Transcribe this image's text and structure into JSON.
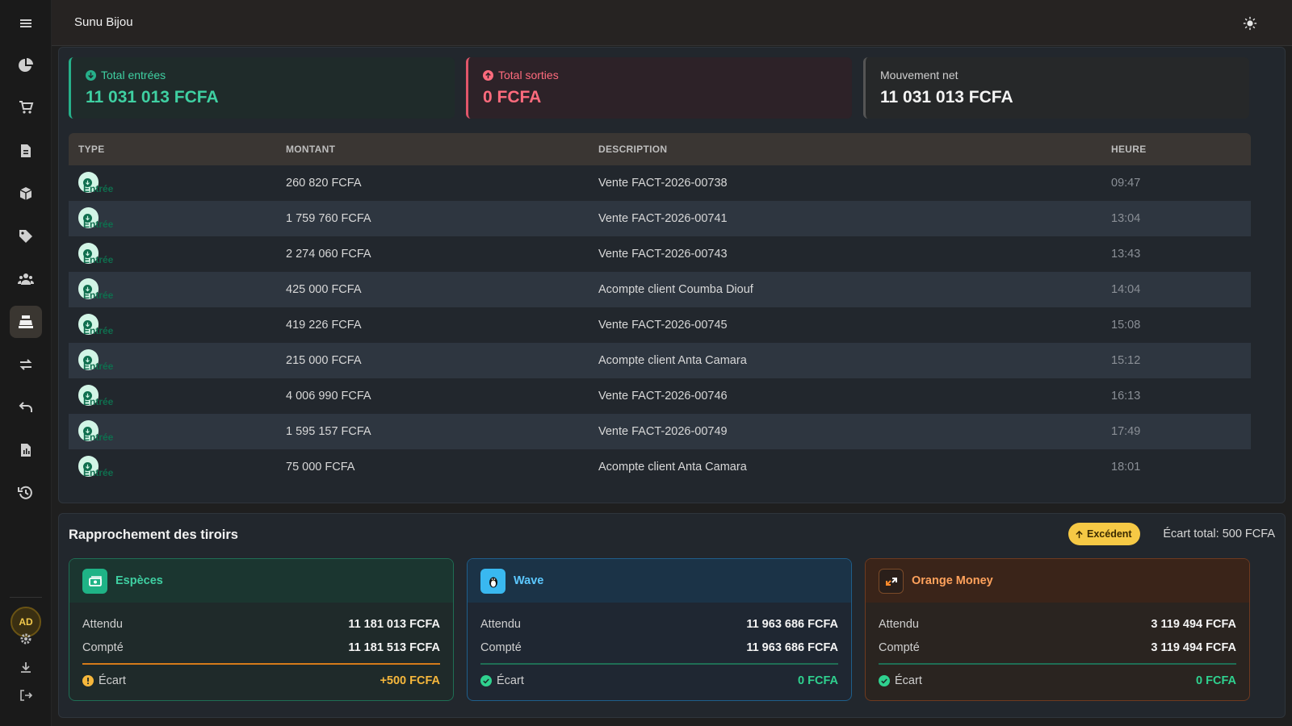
{
  "app": {
    "title": "Sunu Bijou"
  },
  "sidebar": {
    "icons": [
      "menu-icon",
      "dashboard-pie-icon",
      "cart-icon",
      "invoice-icon",
      "box-icon",
      "tag-icon",
      "customers-icon",
      "cash-register-icon",
      "transfer-icon",
      "return-icon",
      "report-icon",
      "history-icon"
    ],
    "active": "cash-register-icon",
    "avatar_initials": "AD"
  },
  "stats": {
    "in_label": "Total entrées",
    "in_value": "11 031 013 FCFA",
    "out_label": "Total sorties",
    "out_value": "0 FCFA",
    "net_label": "Mouvement net",
    "net_value": "11 031 013 FCFA"
  },
  "table": {
    "headers": {
      "type": "TYPE",
      "amount": "MONTANT",
      "description": "DESCRIPTION",
      "time": "HEURE"
    },
    "rows": [
      {
        "type": "Entrée",
        "amount": "260 820 FCFA",
        "description": "Vente FACT-2026-00738",
        "time": "09:47"
      },
      {
        "type": "Entrée",
        "amount": "1 759 760 FCFA",
        "description": "Vente FACT-2026-00741",
        "time": "13:04"
      },
      {
        "type": "Entrée",
        "amount": "2 274 060 FCFA",
        "description": "Vente FACT-2026-00743",
        "time": "13:43"
      },
      {
        "type": "Entrée",
        "amount": "425 000 FCFA",
        "description": "Acompte client Coumba Diouf",
        "time": "14:04"
      },
      {
        "type": "Entrée",
        "amount": "419 226 FCFA",
        "description": "Vente FACT-2026-00745",
        "time": "15:08"
      },
      {
        "type": "Entrée",
        "amount": "215 000 FCFA",
        "description": "Acompte client Anta Camara",
        "time": "15:12"
      },
      {
        "type": "Entrée",
        "amount": "4 006 990 FCFA",
        "description": "Vente FACT-2026-00746",
        "time": "16:13"
      },
      {
        "type": "Entrée",
        "amount": "1 595 157 FCFA",
        "description": "Vente FACT-2026-00749",
        "time": "17:49"
      },
      {
        "type": "Entrée",
        "amount": "75 000 FCFA",
        "description": "Acompte client Anta Camara",
        "time": "18:01"
      }
    ]
  },
  "reconciliation": {
    "title": "Rapprochement des tiroirs",
    "status_badge": "Excédent",
    "total_gap": "Écart total: 500 FCFA",
    "drawers": [
      {
        "name": "Espèces",
        "expected_label": "Attendu",
        "expected": "11 181 013 FCFA",
        "counted_label": "Compté",
        "counted": "11 181 513 FCFA",
        "gap_label": "Écart",
        "gap": "+500 FCFA"
      },
      {
        "name": "Wave",
        "expected_label": "Attendu",
        "expected": "11 963 686 FCFA",
        "counted_label": "Compté",
        "counted": "11 963 686 FCFA",
        "gap_label": "Écart",
        "gap": "0 FCFA"
      },
      {
        "name": "Orange Money",
        "expected_label": "Attendu",
        "expected": "3 119 494 FCFA",
        "counted_label": "Compté",
        "counted": "3 119 494 FCFA",
        "gap_label": "Écart",
        "gap": "0 FCFA"
      }
    ]
  },
  "colors": {
    "entry": "#26b08a",
    "exit": "#e0566a",
    "warning": "#f6c945",
    "wave": "#39b8f0",
    "orange": "#ff8a2a"
  }
}
